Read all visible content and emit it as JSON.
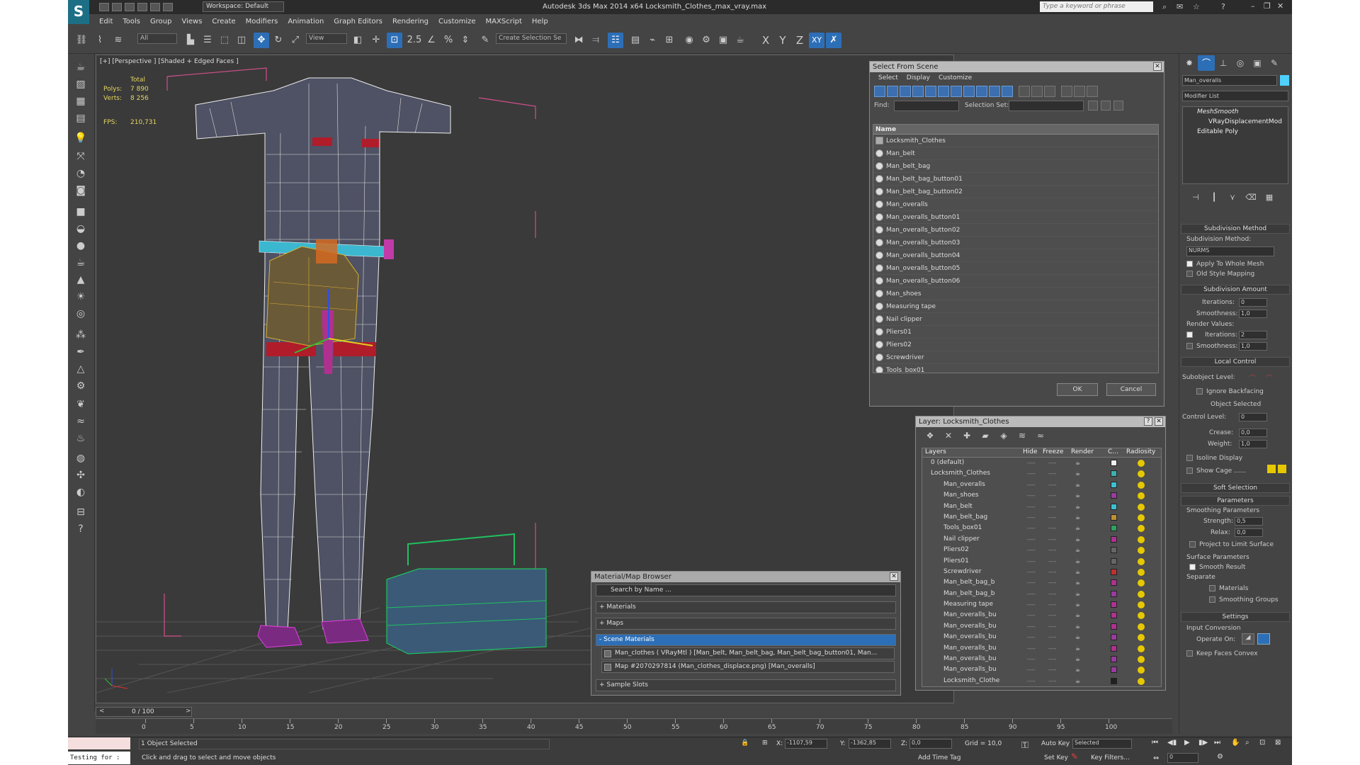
{
  "title": "Autodesk 3ds Max  2014 x64     Locksmith_Clothes_max_vray.max",
  "workspace": "Workspace: Default",
  "search_placeholder": "Type a keyword or phrase",
  "menu": [
    "Edit",
    "Tools",
    "Group",
    "Views",
    "Create",
    "Modifiers",
    "Animation",
    "Graph Editors",
    "Rendering",
    "Customize",
    "MAXScript",
    "Help"
  ],
  "toolbar": {
    "filter": "All",
    "refcoord": "View",
    "selset": "Create Selection Se",
    "axis_x": "X",
    "axis_y": "Y",
    "axis_z": "Z",
    "axis_xy": "XY",
    "snap": "2.5"
  },
  "viewport": {
    "label": "[+] [Perspective ] [Shaded + Edged Faces ]",
    "stats": {
      "total": "Total",
      "polys_label": "Polys:",
      "polys": "7 890",
      "verts_label": "Verts:",
      "verts": "8 256",
      "fps_label": "FPS:",
      "fps": "210,731"
    }
  },
  "select_from_scene": {
    "title": "Select From Scene",
    "tabs": [
      "Select",
      "Display",
      "Customize"
    ],
    "find_label": "Find:",
    "selset_label": "Selection Set:",
    "col_name": "Name",
    "items": [
      "Locksmith_Clothes",
      "Man_belt",
      "Man_belt_bag",
      "Man_belt_bag_button01",
      "Man_belt_bag_button02",
      "Man_overalls",
      "Man_overalls_button01",
      "Man_overalls_button02",
      "Man_overalls_button03",
      "Man_overalls_button04",
      "Man_overalls_button05",
      "Man_overalls_button06",
      "Man_shoes",
      "Measuring tape",
      "Nail clipper",
      "Pliers01",
      "Pliers02",
      "Screwdriver",
      "Tools_box01"
    ],
    "ok": "OK",
    "cancel": "Cancel"
  },
  "layer_dialog": {
    "title": "Layer: Locksmith_Clothes",
    "help": "?",
    "cols": {
      "layers": "Layers",
      "hide": "Hide",
      "freeze": "Freeze",
      "render": "Render",
      "color": "C...",
      "radiosity": "Radiosity"
    },
    "rows": [
      {
        "name": "0 (default)",
        "color": "#f0f0f0"
      },
      {
        "name": "Locksmith_Clothes",
        "color": "#3bb0b0"
      },
      {
        "name": "Man_overalls",
        "color": "#3bc0d0"
      },
      {
        "name": "Man_shoes",
        "color": "#9a3aa0"
      },
      {
        "name": "Man_belt",
        "color": "#3bc0d0"
      },
      {
        "name": "Man_belt_bag",
        "color": "#c09030"
      },
      {
        "name": "Tools_box01",
        "color": "#30a060"
      },
      {
        "name": "Nail clipper",
        "color": "#b03090"
      },
      {
        "name": "Pliers02",
        "color": "#666666"
      },
      {
        "name": "Pliers01",
        "color": "#666666"
      },
      {
        "name": "Screwdriver",
        "color": "#c03030"
      },
      {
        "name": "Man_belt_bag_b",
        "color": "#b03090"
      },
      {
        "name": "Man_belt_bag_b",
        "color": "#9a3aa0"
      },
      {
        "name": "Measuring tape",
        "color": "#b03090"
      },
      {
        "name": "Man_overalls_bu",
        "color": "#b03090"
      },
      {
        "name": "Man_overalls_bu",
        "color": "#b03090"
      },
      {
        "name": "Man_overalls_bu",
        "color": "#9a3aa0"
      },
      {
        "name": "Man_overalls_bu",
        "color": "#b03090"
      },
      {
        "name": "Man_overalls_bu",
        "color": "#9a3aa0"
      },
      {
        "name": "Man_overalls_bu",
        "color": "#9a3aa0"
      },
      {
        "name": "Locksmith_Clothe",
        "color": "#202020"
      }
    ]
  },
  "material_browser": {
    "title": "Material/Map Browser",
    "search_placeholder": "Search by Name ...",
    "groups": [
      "+ Materials",
      "+ Maps",
      "- Scene Materials"
    ],
    "mat1": "Man_clothes ( VRayMtl ) [Man_belt, Man_belt_bag, Man_belt_bag_button01, Man...",
    "mat2": "Map #2070297814 (Man_clothes_displace.png) [Man_overalls]",
    "slots": "+ Sample Slots"
  },
  "command_panel": {
    "object_name": "Man_overalls",
    "modifier_list": "Modifier List",
    "stack": [
      "MeshSmooth",
      "VRayDisplacementMod",
      "Editable Poly"
    ],
    "subdiv_method_title": "Subdivision Method",
    "subdiv_method_label": "Subdivision Method:",
    "subdiv_method_value": "NURMS",
    "apply_whole": "Apply To Whole Mesh",
    "old_style": "Old Style Mapping",
    "subdiv_amount_title": "Subdivision Amount",
    "iterations_label": "Iterations:",
    "iterations": "0",
    "smoothness_label": "Smoothness:",
    "smoothness": "1,0",
    "render_values": "Render Values:",
    "r_iterations_label": "Iterations:",
    "r_iterations": "2",
    "r_smoothness_label": "Smoothness:",
    "r_smoothness": "1,0",
    "local_control_title": "Local Control",
    "subobject_level": "Subobject Level:",
    "ignore_backfacing": "Ignore Backfacing",
    "object_selected": "Object Selected",
    "control_level_label": "Control Level:",
    "control_level": "0",
    "crease_label": "Crease:",
    "crease": "0,0",
    "weight_label": "Weight:",
    "weight": "1,0",
    "isoline": "Isoline Display",
    "show_cage": "Show Cage ......",
    "soft_selection_title": "Soft Selection",
    "parameters_title": "Parameters",
    "smoothing_params": "Smoothing Parameters",
    "strength_label": "Strength:",
    "strength": "0,5",
    "relax_label": "Relax:",
    "relax": "0,0",
    "project_limit": "Project to Limit Surface",
    "surface_params": "Surface Parameters",
    "smooth_result": "Smooth Result",
    "separate": "Separate",
    "materials": "Materials",
    "smoothing_groups": "Smoothing Groups",
    "settings_title": "Settings",
    "input_conversion": "Input Conversion",
    "operate_on": "Operate On:",
    "keep_faces_convex": "Keep Faces Convex"
  },
  "timeline": {
    "frame": "0 / 100",
    "ticks": [
      "0",
      "5",
      "10",
      "15",
      "20",
      "25",
      "30",
      "35",
      "40",
      "45",
      "50",
      "55",
      "60",
      "65",
      "70",
      "75",
      "80",
      "85",
      "90",
      "95",
      "100"
    ]
  },
  "status": {
    "script_listener": "Testing for :",
    "selection": "1 Object Selected",
    "prompt": "Click and drag to select and move objects",
    "x_label": "X:",
    "x": "-1107,59",
    "y_label": "Y:",
    "y": "-1362,85",
    "z_label": "Z:",
    "z": "0,0",
    "grid": "Grid = 10,0",
    "add_time_tag": "Add Time Tag",
    "auto_key": "Auto Key",
    "set_key": "Set Key",
    "key_mode": "Selected",
    "key_filters": "Key Filters...",
    "frame_num": "0"
  }
}
